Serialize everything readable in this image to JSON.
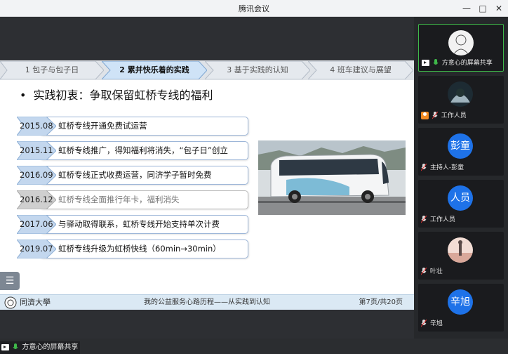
{
  "window": {
    "title": "腾讯会议"
  },
  "nav": {
    "items": [
      {
        "label": "1 包子与包子日",
        "active": false
      },
      {
        "label": "2 累并快乐着的实践",
        "active": true
      },
      {
        "label": "3 基于实践的认知",
        "active": false
      },
      {
        "label": "4 班车建议与展望",
        "active": false
      }
    ]
  },
  "slide": {
    "heading": "实践初衷：争取保留虹桥专线的福利",
    "bullet": "•",
    "timeline": [
      {
        "date": "2015.08",
        "text": "虹桥专线开通免费试运营",
        "dim": false
      },
      {
        "date": "2015.11",
        "text": "虹桥专线推广，得知福利将消失，“包子日”创立",
        "dim": false
      },
      {
        "date": "2016.09",
        "text": "虹桥专线正式收费运营，同济学子暂时免费",
        "dim": false
      },
      {
        "date": "2016.12",
        "text": "虹桥专线全面推行年卡，福利消失",
        "dim": true
      },
      {
        "date": "2017.06",
        "text": "与驿动取得联系，虹桥专线开始支持单次计费",
        "dim": false
      },
      {
        "date": "2019.07",
        "text": "虹桥专线升级为虹桥快线（60min→30min）",
        "dim": false
      }
    ],
    "footer": {
      "logo_text": "同濟大學",
      "center": "我的公益服务心路历程——从实践到认知",
      "pages": "第7页/共20页"
    }
  },
  "bottom_status": {
    "text": "方意心的屏幕共享"
  },
  "participants": [
    {
      "name": "方意心的屏幕共享",
      "avatar_text": "",
      "kind": "share",
      "selected": true
    },
    {
      "name": "工作人员",
      "avatar_text": "",
      "kind": "staff",
      "selected": false
    },
    {
      "name": "主持人-彭童",
      "avatar_text": "彭童",
      "kind": "host",
      "selected": false
    },
    {
      "name": "工作人员",
      "avatar_text": "人员",
      "kind": "normal",
      "selected": false
    },
    {
      "name": "叶壮",
      "avatar_text": "",
      "kind": "normal",
      "selected": false
    },
    {
      "name": "辛旭",
      "avatar_text": "辛旭",
      "kind": "normal",
      "selected": false
    }
  ],
  "colors": {
    "accent_green": "#3fb94a",
    "avatar_blue": "#1e72e8",
    "nav_active": "#cfe3f7"
  },
  "icons": [
    "minimize-icon",
    "maximize-icon",
    "close-icon",
    "list-icon",
    "share-screen-icon",
    "mic-icon",
    "person-icon"
  ]
}
